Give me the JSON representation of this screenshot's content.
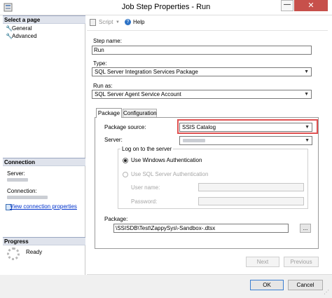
{
  "window": {
    "title": "Job Step Properties - Run",
    "min_glyph": "—",
    "close_glyph": "✕"
  },
  "left_pane": {
    "select_page_header": "Select a page",
    "pages": [
      {
        "label": "General",
        "icon": "wrench-icon"
      },
      {
        "label": "Advanced",
        "icon": "wrench-icon"
      }
    ],
    "connection_header": "Connection",
    "server_label": "Server:",
    "connection_label": "Connection:",
    "view_connection_link": "View connection properties",
    "progress_header": "Progress",
    "progress_status": "Ready"
  },
  "toolbar": {
    "script_label": "Script",
    "dropdown_glyph": "▼",
    "help_label": "Help"
  },
  "form": {
    "step_name_label": "Step name:",
    "step_name_value": "Run",
    "type_label": "Type:",
    "type_value": "SQL Server Integration Services Package",
    "run_as_label": "Run as:",
    "run_as_value": "SQL Server Agent Service Account"
  },
  "tabs": [
    {
      "label": "Package",
      "selected": true
    },
    {
      "label": "Configuration",
      "selected": false
    }
  ],
  "package_tab": {
    "package_source_label": "Package source:",
    "package_source_value": "SSIS Catalog",
    "server_label": "Server:",
    "logon_group_title": "Log on to the server",
    "windows_auth_label": "Use Windows Authentication",
    "sql_auth_label": "Use SQL Server Authentication",
    "user_name_label": "User name:",
    "password_label": "Password:",
    "package_label": "Package:",
    "package_value": "\\SSISDB\\Test\\ZappySys\\-Sandbox-.dtsx",
    "browse_label": "..."
  },
  "buttons": {
    "next": "Next",
    "previous": "Previous",
    "ok": "OK",
    "cancel": "Cancel"
  },
  "colors": {
    "highlight": "#e05252",
    "close_button": "#c7504b",
    "link": "#0033cc",
    "section_header": "#dfe3ec"
  }
}
